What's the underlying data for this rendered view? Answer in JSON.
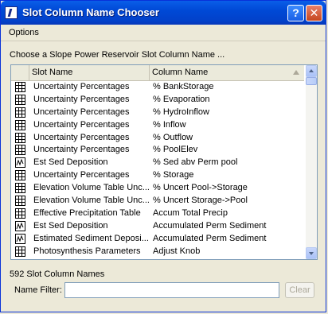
{
  "window": {
    "title": "Slot Column Name Chooser",
    "help_label": "?",
    "close_label": "✕"
  },
  "menu": {
    "options_label": "Options"
  },
  "prompt": "Choose a Slope Power Reservoir Slot Column Name ...",
  "table": {
    "columns": [
      "Slot Name",
      "Column Name"
    ],
    "rows": [
      {
        "icon": "table-icon",
        "slot": "Uncertainty Percentages",
        "column": "% BankStorage"
      },
      {
        "icon": "table-icon",
        "slot": "Uncertainty Percentages",
        "column": "% Evaporation"
      },
      {
        "icon": "table-icon",
        "slot": "Uncertainty Percentages",
        "column": "% HydroInflow"
      },
      {
        "icon": "table-icon",
        "slot": "Uncertainty Percentages",
        "column": "% Inflow"
      },
      {
        "icon": "table-icon",
        "slot": "Uncertainty Percentages",
        "column": "% Outflow"
      },
      {
        "icon": "table-icon",
        "slot": "Uncertainty Percentages",
        "column": "% PoolElev"
      },
      {
        "icon": "series-icon",
        "slot": "Est Sed Deposition",
        "column": "% Sed abv Perm pool"
      },
      {
        "icon": "table-icon",
        "slot": "Uncertainty Percentages",
        "column": "% Storage"
      },
      {
        "icon": "table-icon",
        "slot": "Elevation Volume Table Unc...",
        "column": "% Uncert Pool->Storage"
      },
      {
        "icon": "table-icon",
        "slot": "Elevation Volume Table Unc...",
        "column": "% Uncert Storage->Pool"
      },
      {
        "icon": "table-icon",
        "slot": "Effective Precipitation Table",
        "column": "Accum Total Precip"
      },
      {
        "icon": "series-icon",
        "slot": "Est Sed Deposition",
        "column": "Accumulated Perm Sediment"
      },
      {
        "icon": "series-icon",
        "slot": "Estimated Sediment Deposi...",
        "column": "Accumulated Perm Sediment"
      },
      {
        "icon": "table-icon",
        "slot": "Photosynthesis Parameters",
        "column": "Adjust Knob"
      }
    ]
  },
  "status": {
    "count_text": "592 Slot Column Names"
  },
  "filter": {
    "label": "Name Filter:",
    "value": "",
    "placeholder": "",
    "clear_label": "Clear"
  }
}
